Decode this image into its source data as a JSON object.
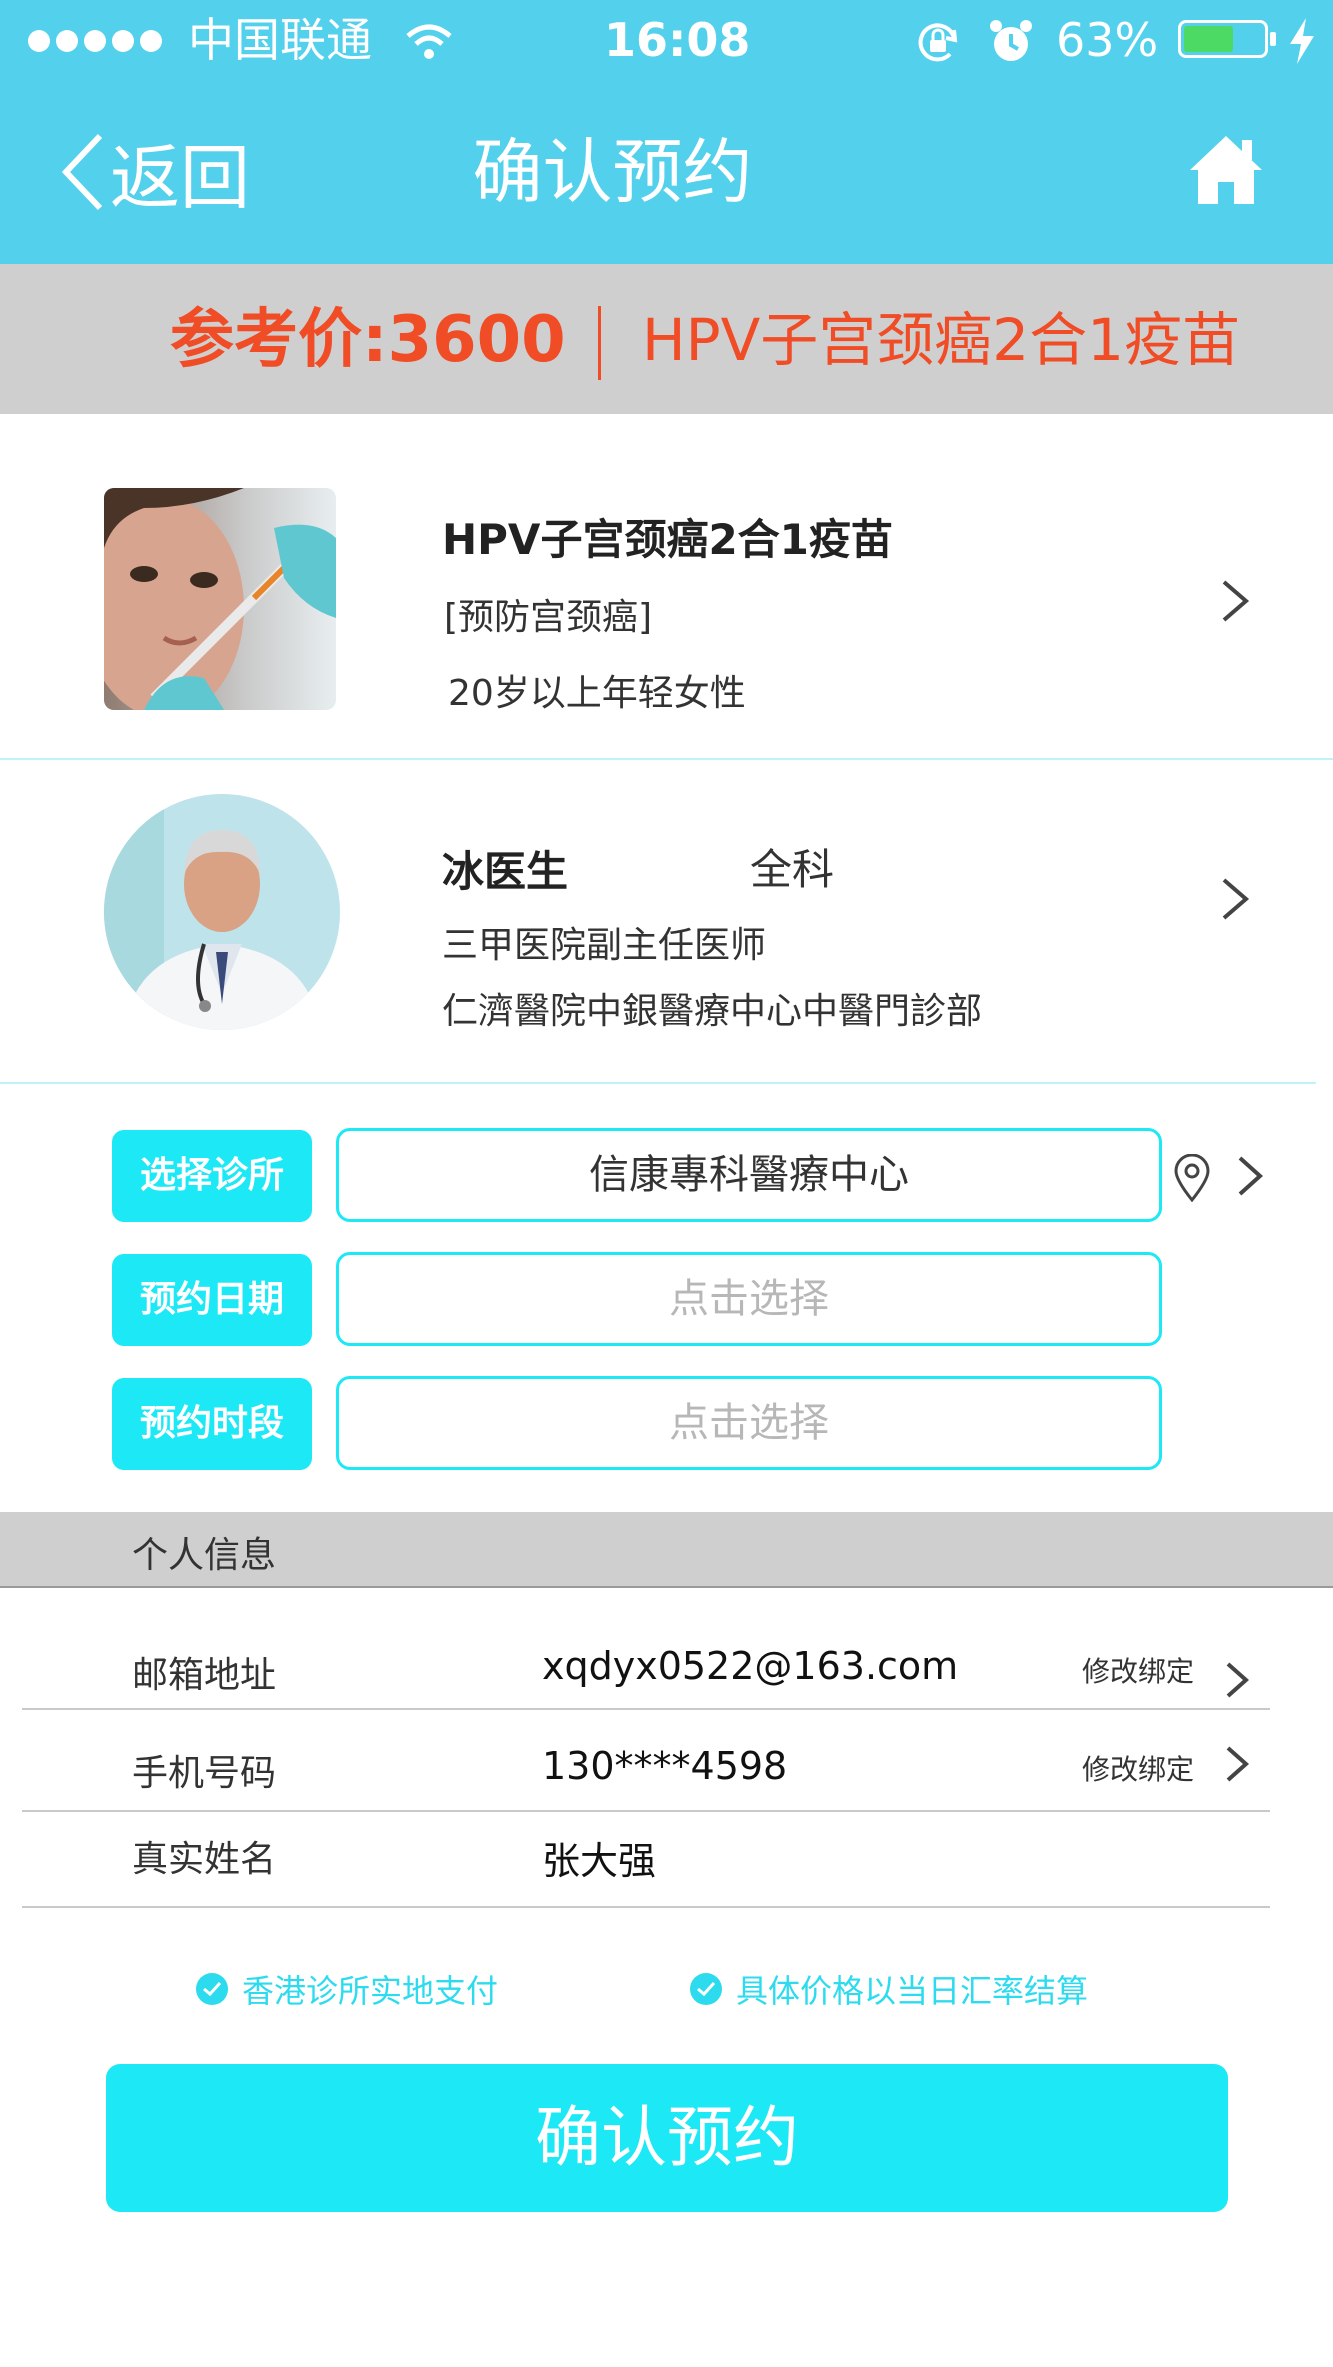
{
  "status_bar": {
    "carrier": "中国联通",
    "time": "16:08",
    "battery": "63%",
    "battery_level": 0.63,
    "signal_dots": 5
  },
  "nav": {
    "back_label": "返回",
    "title": "确认预约"
  },
  "price_band": {
    "price_label": "参考价:3600",
    "product_name": "HPV子宫颈癌2合1疫苗"
  },
  "vaccine": {
    "title": "HPV子宫颈癌2合1疫苗",
    "tag": "[预防宫颈癌]",
    "audience": "20岁以上年轻女性"
  },
  "doctor": {
    "name": "冰医生",
    "department": "全科",
    "title": "三甲医院副主任医师",
    "hospital": "仁濟醫院中銀醫療中心中醫門診部"
  },
  "booking_form": {
    "clinic_label": "选择诊所",
    "clinic_value": "信康專科醫療中心",
    "date_label": "预约日期",
    "date_placeholder": "点击选择",
    "time_label": "预约时段",
    "time_placeholder": "点击选择"
  },
  "personal_info": {
    "section_title": "个人信息",
    "email_label": "邮箱地址",
    "email_value": "xqdyx0522@163.com",
    "phone_label": "手机号码",
    "phone_value": "130****4598",
    "name_label": "真实姓名",
    "name_value": "张大强",
    "modify_binding_label": "修改绑定"
  },
  "notes": {
    "payment_note": "香港诊所实地支付",
    "price_note": "具体价格以当日汇率结算"
  },
  "confirm_button_label": "确认预约",
  "colors": {
    "header": "#52d0ec",
    "accent": "#1de8f5",
    "price": "#f04c25",
    "band": "#cfcfcf"
  }
}
